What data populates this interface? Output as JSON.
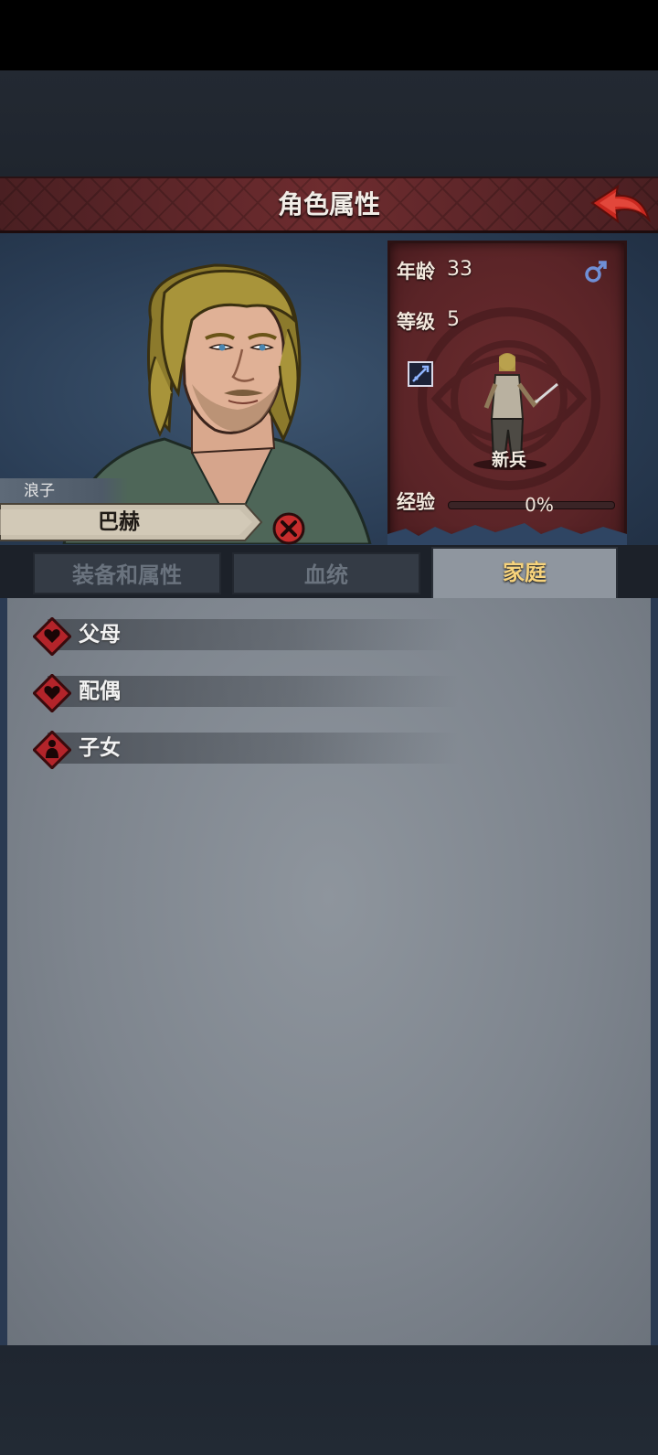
{
  "header": {
    "title": "角色属性"
  },
  "character": {
    "title": "浪子",
    "name": "巴赫",
    "age_label": "年龄",
    "age_value": "33",
    "level_label": "等级",
    "level_value": "5",
    "unit_label": "新兵",
    "xp_label": "经验",
    "xp_text": "0%",
    "xp_fraction": 0.0,
    "gender_icon": "male-symbol-icon",
    "class_icon": "sword-icon"
  },
  "tabs": [
    {
      "label": "装备和属性",
      "active": false
    },
    {
      "label": "血统",
      "active": false
    },
    {
      "label": "家庭",
      "active": true
    }
  ],
  "family": [
    {
      "label": "父母",
      "icon": "heart-icon"
    },
    {
      "label": "配偶",
      "icon": "heart-icon"
    },
    {
      "label": "子女",
      "icon": "child-icon"
    }
  ],
  "colors": {
    "header_red": "#6e2c2f",
    "card_red": "#5a2427",
    "active_tab_text": "#f7d37c",
    "accent_red": "#c02b2b"
  }
}
